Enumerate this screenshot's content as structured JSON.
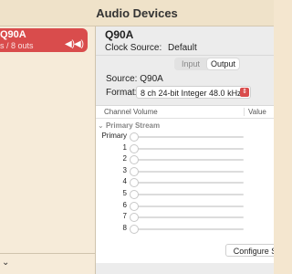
{
  "window": {
    "title": "Audio Devices"
  },
  "sidebar": {
    "device": {
      "name": "Q90A",
      "subtitle": "s / 8 outs",
      "icon": "speaker-icon"
    }
  },
  "device_panel": {
    "name": "Q90A",
    "clock_source_label": "Clock Source:",
    "clock_source_value": "Default",
    "tabs": [
      "Input",
      "Output"
    ],
    "active_tab": "Output",
    "source_label": "Source:",
    "source_value": "Q90A",
    "format_label": "Format:",
    "format_value": "8 ch 24-bit Integer 48.0 kHz"
  },
  "volume_table": {
    "columns": [
      "Channel Volume",
      "Value"
    ],
    "group": "Primary Stream",
    "channels": [
      {
        "label": "Primary",
        "volume": 0
      },
      {
        "label": "1",
        "volume": 0
      },
      {
        "label": "2",
        "volume": 0
      },
      {
        "label": "3",
        "volume": 0
      },
      {
        "label": "4",
        "volume": 0
      },
      {
        "label": "5",
        "volume": 0
      },
      {
        "label": "6",
        "volume": 0
      },
      {
        "label": "7",
        "volume": 0
      },
      {
        "label": "8",
        "volume": 0
      }
    ]
  },
  "footer": {
    "configure_label": "Configure Sp"
  },
  "colors": {
    "accent": "#d94c4c",
    "titlebar": "#efe2c9",
    "sidebar": "#f6ebd9"
  }
}
